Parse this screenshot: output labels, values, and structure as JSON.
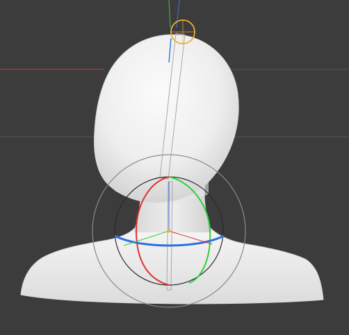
{
  "viewport": {
    "background": "#3c3c3c",
    "grid_color": "#555555",
    "world_x_axis_color": "#c23b3b",
    "world_z_axis_color": "#3a6ec2",
    "world_y_axis_color": "#3fae4a",
    "model_color": "#f2f2f2",
    "model_shade_color": "#cfcfcf",
    "gizmo": {
      "type": "rotate",
      "x_ring_color": "#e03030",
      "y_ring_color": "#2fcf3a",
      "z_ring_color": "#2f6fe0",
      "outer_ring_color": "#8a8a8a",
      "view_ring_color": "#4a4a4a",
      "selected_joint_color": "#f0b030"
    },
    "bone": {
      "color": "#a8a8a8"
    }
  }
}
